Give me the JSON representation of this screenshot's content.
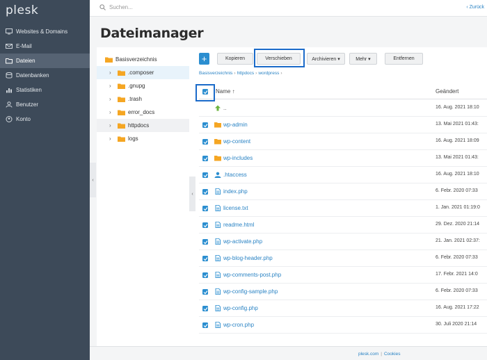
{
  "app": {
    "logo": "plesk"
  },
  "sidebar": {
    "items": [
      {
        "label": "Websites & Domains",
        "icon": "monitor-icon",
        "active": false
      },
      {
        "label": "E-Mail",
        "icon": "mail-icon",
        "active": false
      },
      {
        "label": "Dateien",
        "icon": "folder-icon",
        "active": true
      },
      {
        "label": "Datenbanken",
        "icon": "database-icon",
        "active": false
      },
      {
        "label": "Statistiken",
        "icon": "chart-icon",
        "active": false
      },
      {
        "label": "Benutzer",
        "icon": "users-icon",
        "active": false
      },
      {
        "label": "Konto",
        "icon": "account-icon",
        "active": false
      }
    ]
  },
  "topbar": {
    "search_placeholder": "Suchen...",
    "back_label": "‹ Zurück"
  },
  "page": {
    "title": "Dateimanager"
  },
  "tree": {
    "root": "Basisverzeichnis",
    "items": [
      {
        "label": ".composer",
        "selected": true
      },
      {
        "label": ".gnupg",
        "selected": false
      },
      {
        "label": ".trash",
        "selected": false
      },
      {
        "label": "error_docs",
        "selected": false
      },
      {
        "label": "httpdocs",
        "selected": false,
        "hover": true
      },
      {
        "label": "logs",
        "selected": false
      }
    ]
  },
  "toolbar": {
    "add_label": "+",
    "copy_label": "Kopieren",
    "move_label": "Verschieben",
    "archive_label": "Archivieren ▾",
    "more_label": "Mehr ▾",
    "remove_label": "Entfernen"
  },
  "breadcrumb": {
    "items": [
      "Basisverzeichnis",
      "httpdocs",
      "wordpress"
    ]
  },
  "table": {
    "columns": {
      "name": "Name ↑",
      "changed": "Geändert"
    },
    "rows": [
      {
        "name": "..",
        "type": "up",
        "date": "16. Aug. 2021 18:10",
        "checked": false
      },
      {
        "name": "wp-admin",
        "type": "folder",
        "date": "13. Mai 2021 01:43:",
        "checked": true
      },
      {
        "name": "wp-content",
        "type": "folder",
        "date": "16. Aug. 2021 18:09",
        "checked": true
      },
      {
        "name": "wp-includes",
        "type": "folder",
        "date": "13. Mai 2021 01:43:",
        "checked": true
      },
      {
        "name": ".htaccess",
        "type": "user",
        "date": "16. Aug. 2021 18:10",
        "checked": true
      },
      {
        "name": "index.php",
        "type": "file",
        "date": "6. Febr. 2020 07:33",
        "checked": true
      },
      {
        "name": "license.txt",
        "type": "file",
        "date": "1. Jan. 2021 01:19:0",
        "checked": true
      },
      {
        "name": "readme.html",
        "type": "file",
        "date": "29. Dez. 2020 21:14",
        "checked": true
      },
      {
        "name": "wp-activate.php",
        "type": "file",
        "date": "21. Jan. 2021 02:37:",
        "checked": true
      },
      {
        "name": "wp-blog-header.php",
        "type": "file",
        "date": "6. Febr. 2020 07:33",
        "checked": true
      },
      {
        "name": "wp-comments-post.php",
        "type": "file",
        "date": "17. Febr. 2021 14:0",
        "checked": true
      },
      {
        "name": "wp-config-sample.php",
        "type": "file",
        "date": "6. Febr. 2020 07:33",
        "checked": true
      },
      {
        "name": "wp-config.php",
        "type": "file",
        "date": "16. Aug. 2021 17:22",
        "checked": true
      },
      {
        "name": "wp-cron.php",
        "type": "file",
        "date": "30. Juli 2020 21:14",
        "checked": true
      }
    ]
  },
  "footer": {
    "link1": "plesk.com",
    "sep": "|",
    "link2": "Cookies"
  },
  "colors": {
    "accent": "#2b8ed0",
    "sidebar": "#3d4a59",
    "highlight": "#1a6ac9",
    "folder": "#f5a623"
  }
}
